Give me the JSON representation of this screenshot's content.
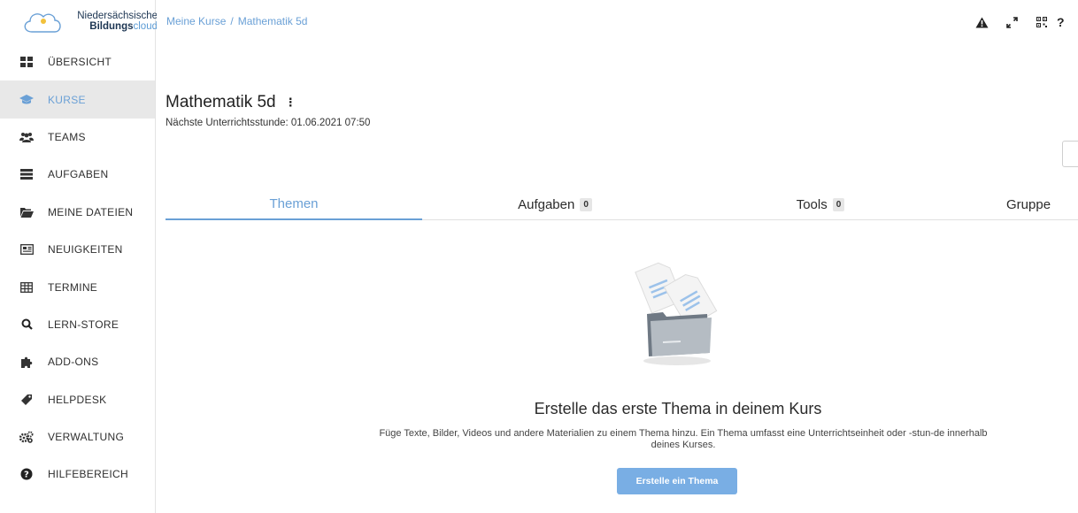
{
  "brand": {
    "line1": "Niedersächsische",
    "line2_bold": "Bildungs",
    "line2_light": "cloud",
    "logo_icon": "cloud-logo-icon"
  },
  "sidebar": {
    "items": [
      {
        "label": "ÜBERSICHT",
        "icon": "dashboard-icon",
        "active": false
      },
      {
        "label": "KURSE",
        "icon": "graduation-cap-icon",
        "active": true
      },
      {
        "label": "TEAMS",
        "icon": "users-icon",
        "active": false
      },
      {
        "label": "AUFGABEN",
        "icon": "tasks-icon",
        "active": false
      },
      {
        "label": "MEINE DATEIEN",
        "icon": "folder-open-icon",
        "active": false
      },
      {
        "label": "NEUIGKEITEN",
        "icon": "newspaper-icon",
        "active": false
      },
      {
        "label": "TERMINE",
        "icon": "calendar-table-icon",
        "active": false
      },
      {
        "label": "LERN-STORE",
        "icon": "search-icon",
        "active": false
      },
      {
        "label": "ADD-ONS",
        "icon": "puzzle-icon",
        "active": false
      },
      {
        "label": "HELPDESK",
        "icon": "tag-icon",
        "active": false
      },
      {
        "label": "VERWALTUNG",
        "icon": "cogs-icon",
        "active": false
      },
      {
        "label": "HILFEBEREICH",
        "icon": "question-circle-icon",
        "active": false
      }
    ]
  },
  "header": {
    "breadcrumb": [
      "Meine Kurse",
      "Mathematik 5d"
    ],
    "breadcrumb_separator": "/",
    "icons": [
      "warning-icon",
      "fullscreen-icon",
      "qr-code-icon",
      "help-icon"
    ],
    "help_label": "?"
  },
  "course": {
    "title": "Mathematik 5d",
    "more_label": "⋮",
    "next_lesson": "Nächste Unterrichtsstunde: 01.06.2021 07:50"
  },
  "tabs": [
    {
      "label": "Themen",
      "badge": null,
      "active": true
    },
    {
      "label": "Aufgaben",
      "badge": "0",
      "active": false
    },
    {
      "label": "Tools",
      "badge": "0",
      "active": false
    },
    {
      "label": "Gruppe",
      "badge": null,
      "active": false
    }
  ],
  "empty_state": {
    "illustration": "empty-folder-documents-icon",
    "title": "Erstelle das erste Thema in deinem Kurs",
    "description": "Füge Texte, Bilder, Videos und andere Materialien zu einem Thema hinzu. Ein Thema umfasst eine Unterrichtseinheit oder -stun-de innerhalb deines Kurses.",
    "button_label": "Erstelle ein Thema"
  },
  "colors": {
    "accent": "#6aa0d6",
    "button": "#79aee4",
    "active_bg": "#e8e8e8"
  }
}
